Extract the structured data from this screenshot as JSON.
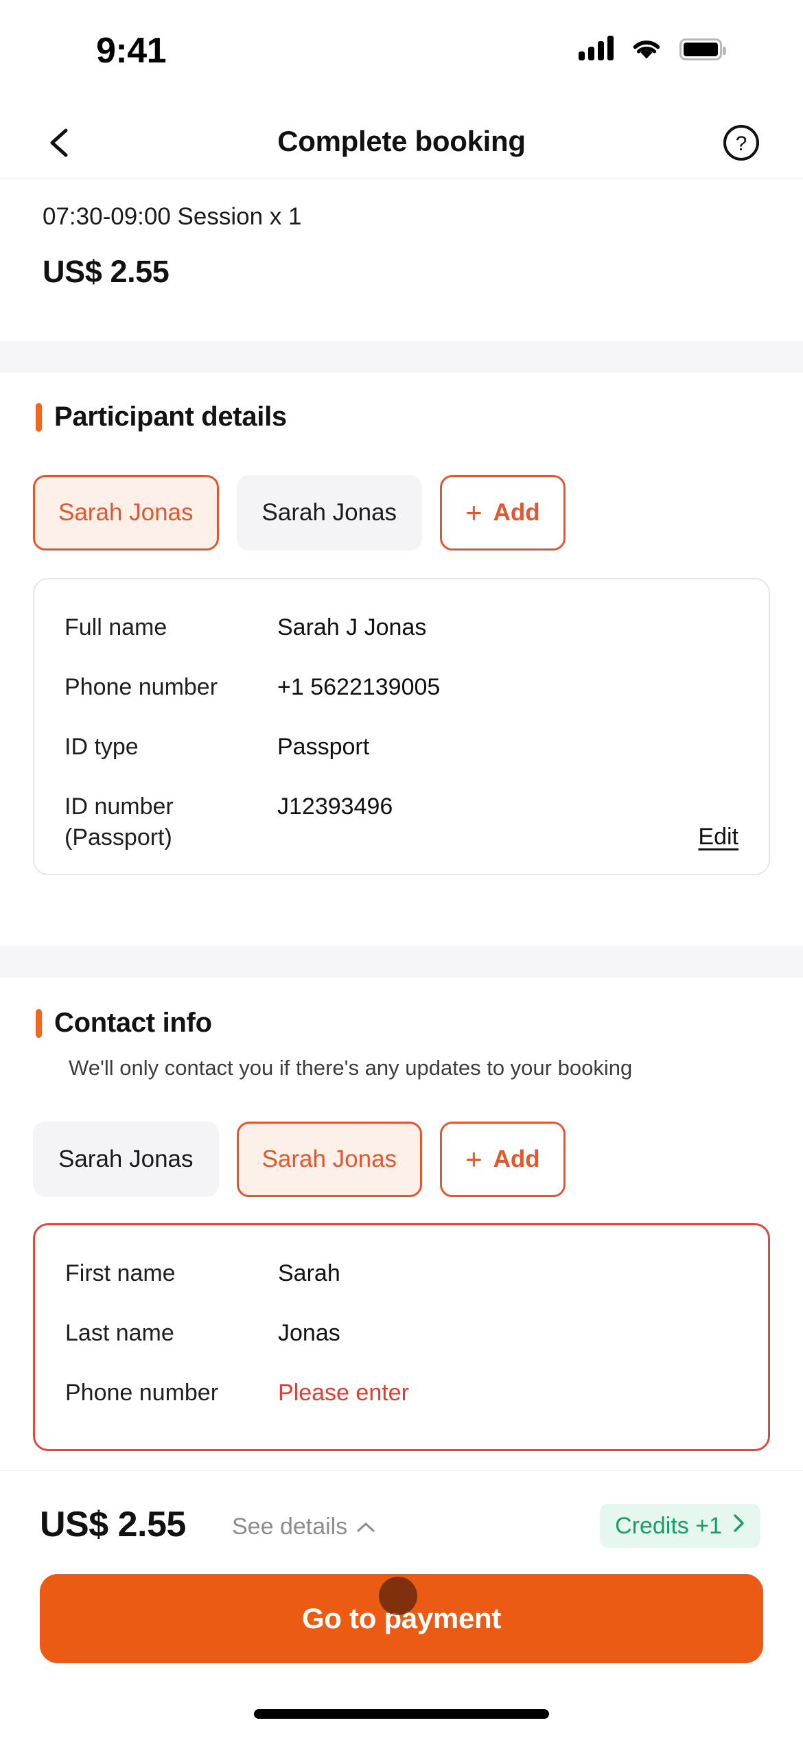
{
  "status_bar": {
    "time": "9:41",
    "signal_icon": "signal-bars-icon",
    "wifi_icon": "wifi-icon",
    "battery_icon": "battery-full-icon"
  },
  "nav": {
    "back_icon": "chevron-left-icon",
    "title": "Complete booking",
    "help_icon": "help-circle-icon"
  },
  "summary": {
    "session": "07:30-09:00 Session x 1",
    "price": "US$ 2.55"
  },
  "participant_section": {
    "title": "Participant details",
    "chips": [
      {
        "label": "Sarah Jonas",
        "state": "selected"
      },
      {
        "label": "Sarah Jonas",
        "state": "idle"
      },
      {
        "label": "Add",
        "state": "add",
        "icon": "plus-icon"
      }
    ],
    "fields": [
      {
        "key": "Full name",
        "value": "Sarah J Jonas"
      },
      {
        "key": "Phone number",
        "value": "+1 5622139005"
      },
      {
        "key": "ID type",
        "value": "Passport"
      },
      {
        "key": "ID number (Passport)",
        "value": "J12393496"
      }
    ],
    "edit_label": "Edit"
  },
  "contact_section": {
    "title": "Contact info",
    "subtitle": "We'll only contact you if there's any updates to your booking",
    "chips": [
      {
        "label": "Sarah Jonas",
        "state": "idle"
      },
      {
        "label": "Sarah Jonas",
        "state": "selected"
      },
      {
        "label": "Add",
        "state": "add",
        "icon": "plus-icon"
      }
    ],
    "fields": [
      {
        "key": "First name",
        "value": "Sarah",
        "error": false
      },
      {
        "key": "Last name",
        "value": "Jonas",
        "error": false
      },
      {
        "key": "Phone number",
        "value": "Please enter",
        "error": true
      }
    ]
  },
  "bottom_bar": {
    "price": "US$ 2.55",
    "details_label": "See details",
    "details_chevron": "chevron-up-icon",
    "credits_label": "Credits +1",
    "credits_chevron": "chevron-right-icon",
    "cta_label": "Go to payment"
  },
  "colors": {
    "accent_orange": "#ec5b13",
    "chip_orange": "#e4572e",
    "chip_fill": "#fdf0e8",
    "error_red": "#e03c31",
    "credit_green": "#1a9e62",
    "credit_bg": "#e6f7ef"
  }
}
